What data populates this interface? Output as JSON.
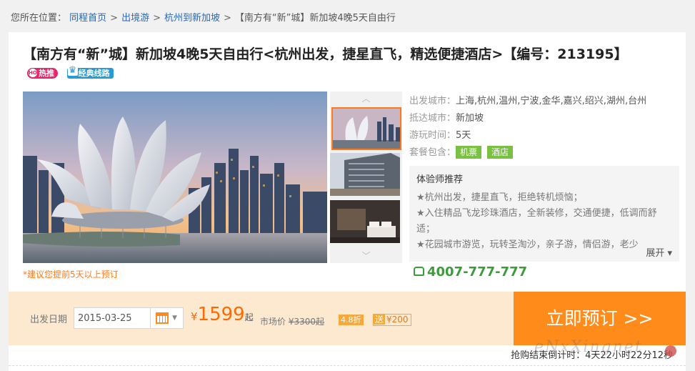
{
  "breadcrumb": {
    "prefix": "您所在位置：",
    "items": [
      "同程首页",
      "出境游",
      "杭州到新加坡"
    ],
    "separator": ">",
    "current": "【南方有“新”城】新加坡4晚5天自由行"
  },
  "product": {
    "title": "【南方有“新”城】新加坡4晚5天自由行<杭州出发，捷星直飞，精选便捷酒店>【编号：213195】",
    "tags": {
      "hot": "热推",
      "classic": "经典线路",
      "hot_icon_text": "HOT"
    },
    "advance_note": "*建议您提前5天以上预订"
  },
  "info": {
    "departure_label": "出发城市：",
    "departure_value": "上海,杭州,温州,宁波,金华,嘉兴,绍兴,湖州,台州",
    "arrival_label": "抵达城市：",
    "arrival_value": "新加坡",
    "duration_label": "游玩时间：",
    "duration_value": "5天",
    "package_label": "套餐包含：",
    "package_items": [
      "机票",
      "酒店"
    ]
  },
  "recommend": {
    "title": "体验师推荐",
    "items": [
      "★杭州出发，捷星直飞，拒绝转机烦恼；",
      "★入住精品飞龙珍珠酒店，全新装修，交通便捷，低调而舒适；",
      "★花园城市游览，玩转圣淘沙，亲子游，情侣游，老少"
    ],
    "more": "展开"
  },
  "hotline": "4007-777-777",
  "booking": {
    "date_label": "出发日期",
    "date_value": "2015-03-25",
    "currency": "¥",
    "price": "1599",
    "price_suffix": "起",
    "market_label": "市场价",
    "market_price": "¥3300起",
    "discount": "4.8折",
    "gift_label": "送",
    "gift_value": "¥200",
    "book_button": "立即预订 >>"
  },
  "countdown": "抢购结束倒计时：4天22小时22分12秒",
  "watermark": "eNxXingnet",
  "colors": {
    "accent": "#ff8c1a",
    "link": "#2a67b6",
    "green": "#7ac143",
    "hot": "#e6256a"
  },
  "icons": [
    "hot-icon",
    "trophy-icon",
    "phone-icon",
    "calendar-icon",
    "chevron-up-icon",
    "chevron-down-icon",
    "caret-down-icon"
  ]
}
